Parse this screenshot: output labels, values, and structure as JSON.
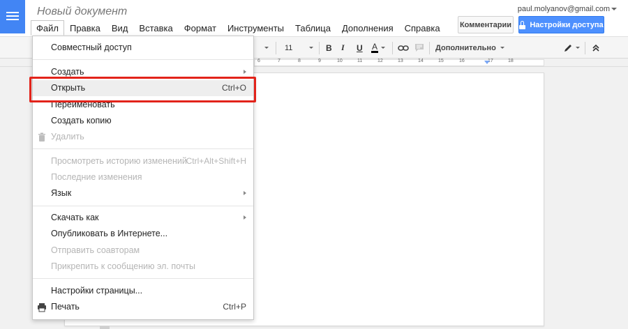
{
  "header": {
    "doc_title": "Новый документ",
    "user_email": "paul.molyanov@gmail.com",
    "comments_label": "Комментарии",
    "share_label": "Настройки доступа"
  },
  "menubar": [
    "Файл",
    "Правка",
    "Вид",
    "Вставка",
    "Формат",
    "Инструменты",
    "Таблица",
    "Дополнения",
    "Справка"
  ],
  "toolbar": {
    "font_size": "11",
    "bold": "B",
    "italic": "I",
    "underline": "U",
    "text_color": "A",
    "more_label": "Дополнительно"
  },
  "ruler": [
    "6",
    "7",
    "8",
    "9",
    "10",
    "11",
    "12",
    "13",
    "14",
    "15",
    "16",
    "17",
    "18"
  ],
  "file_menu": {
    "share": "Совместный доступ",
    "create": "Создать",
    "open": "Открыть",
    "open_shortcut": "Ctrl+O",
    "rename": "Переименовать",
    "make_copy": "Создать копию",
    "delete": "Удалить",
    "history": "Просмотреть историю изменений",
    "history_shortcut": "Ctrl+Alt+Shift+H",
    "recent_changes": "Последние изменения",
    "language": "Язык",
    "download": "Скачать как",
    "publish": "Опубликовать в Интернете...",
    "send_collaborators": "Отправить соавторам",
    "attach_email": "Прикрепить к сообщению эл. почты",
    "page_setup": "Настройки страницы...",
    "print": "Печать",
    "print_shortcut": "Ctrl+P"
  },
  "colors": {
    "accent": "#4285f4",
    "share_button": "#4d90fe",
    "annotation": "#e2231a"
  }
}
